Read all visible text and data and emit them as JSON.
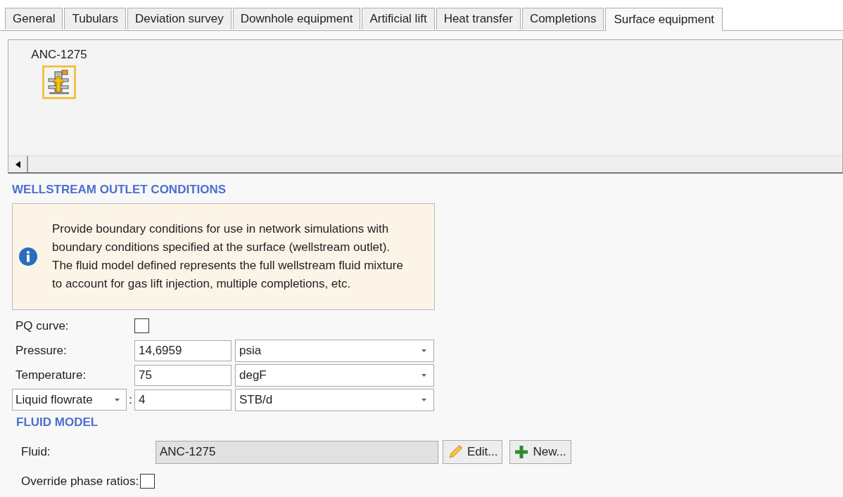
{
  "tabs": [
    {
      "label": "General",
      "selected": false
    },
    {
      "label": "Tubulars",
      "selected": false
    },
    {
      "label": "Deviation survey",
      "selected": false
    },
    {
      "label": "Downhole equipment",
      "selected": false
    },
    {
      "label": "Artificial lift",
      "selected": false
    },
    {
      "label": "Heat transfer",
      "selected": false
    },
    {
      "label": "Completions",
      "selected": false
    },
    {
      "label": "Surface equipment",
      "selected": true
    }
  ],
  "canvas": {
    "nodes": [
      {
        "label": "ANC-1275",
        "selected": true
      }
    ]
  },
  "wellstream_outlet_conditions": {
    "heading": "WELLSTREAM OUTLET CONDITIONS",
    "info": "Provide boundary conditions for use in network simulations with boundary conditions specified at the surface (wellstream outlet).  The fluid model defined represents the full wellstream fluid mixture to account for gas lift injection, multiple completions, etc.",
    "rows": [
      {
        "kind": "checkbox",
        "label": "PQ curve:",
        "checked": false
      },
      {
        "kind": "input",
        "label": "Pressure:",
        "value": "14,6959",
        "unit": "psia"
      },
      {
        "kind": "input",
        "label": "Temperature:",
        "value": "75",
        "unit": "degF"
      },
      {
        "kind": "select-input",
        "label": "Liquid flowrate",
        "separator": ":",
        "value": "4",
        "unit": "STB/d"
      }
    ]
  },
  "fluid_model": {
    "heading": "FLUID MODEL",
    "fluid_label": "Fluid:",
    "fluid_value": "ANC-1275",
    "fluid_disabled": true,
    "buttons": [
      {
        "kind": "edit",
        "label": "Edit..."
      },
      {
        "kind": "new",
        "label": "New..."
      }
    ],
    "override_label": "Override phase ratios:",
    "override_checked": false
  }
}
